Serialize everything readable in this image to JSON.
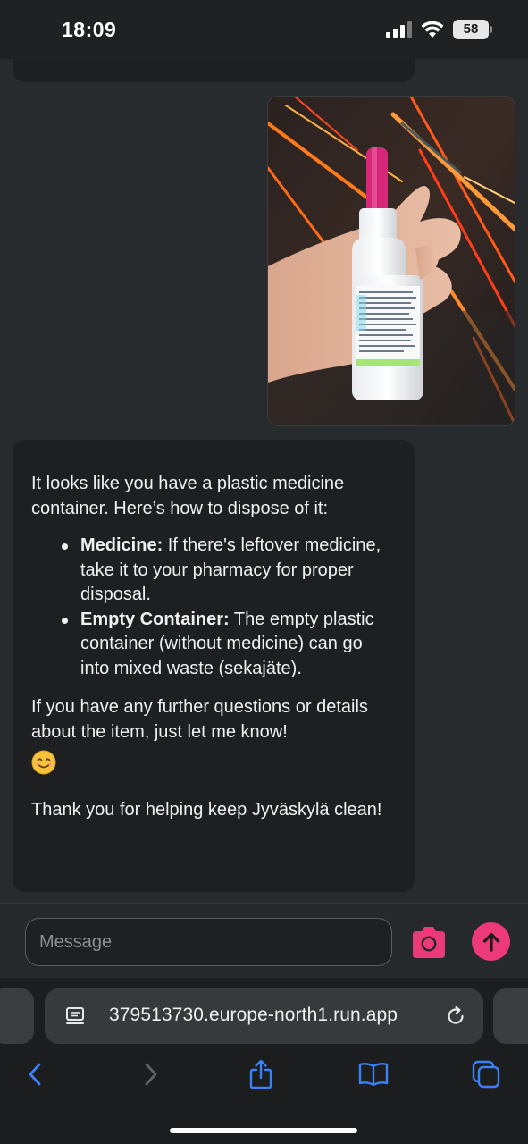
{
  "status_bar": {
    "time": "18:09",
    "battery": "58",
    "icons": [
      "signal-icon",
      "wifi-icon",
      "battery-icon"
    ]
  },
  "chat": {
    "photo_alt": "hand holding plastic medicine bottle with pink nozzle",
    "bot_message": {
      "intro": "It looks like you have a plastic medicine container. Here’s how to dispose of it:",
      "items": [
        {
          "label": "Medicine:",
          "text": " If there's leftover medicine, take it to your pharmacy for proper disposal."
        },
        {
          "label": "Empty Container:",
          "text": " The empty plastic container (without medicine) can go into mixed waste (sekajäte)."
        }
      ],
      "followup": "If you have any further questions or details about the item, just let me know!",
      "closing": "Thank you for helping keep Jyväskylä clean!"
    }
  },
  "composer": {
    "placeholder": "Message",
    "accent_color": "#ec3a78"
  },
  "browser": {
    "url": "379513730.europe-north1.run.app",
    "accent_color": "#3b82f6"
  }
}
